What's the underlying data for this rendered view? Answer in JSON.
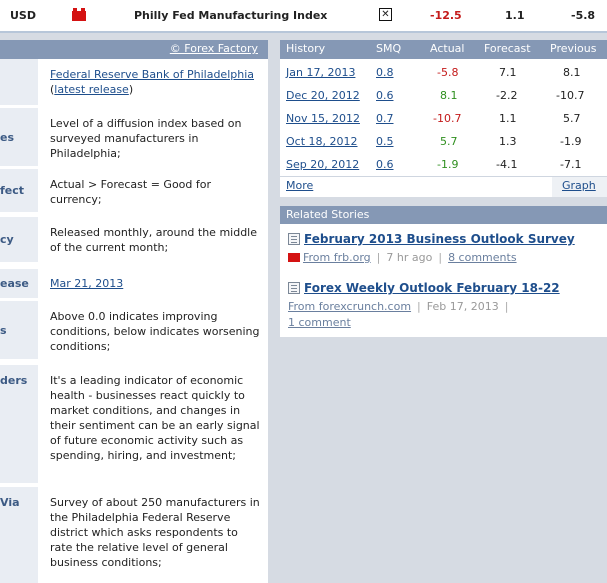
{
  "event": {
    "currency": "USD",
    "title": "Philly Fed Manufacturing Index",
    "checkbox": "✕",
    "actual": "-12.5",
    "forecast": "1.1",
    "previous": "-5.8"
  },
  "details": {
    "source_link": "© Forex Factory",
    "rows": [
      {
        "label": "",
        "value_parts": [
          "Federal Reserve Bank of Philadelphia",
          " (",
          "latest release",
          ")"
        ]
      },
      {
        "label": "es",
        "value": "Level of a diffusion index based on surveyed manufacturers in Philadelphia;"
      },
      {
        "label": "fect",
        "value": "Actual > Forecast = Good for currency;"
      },
      {
        "label": "cy",
        "value": "Released monthly, around the middle of the current month;"
      },
      {
        "label": "ease",
        "value": "Mar 21, 2013"
      },
      {
        "label": "s",
        "value": "Above 0.0 indicates improving conditions, below indicates worsening conditions;"
      },
      {
        "label": "ders",
        "value": "It's a leading indicator of economic health - businesses react quickly to market conditions, and changes in their sentiment can be an early signal of future economic activity such as spending, hiring, and investment;"
      },
      {
        "label": "Via",
        "value": "Survey of about 250 manufacturers in the Philadelphia Federal Reserve district which asks respondents to rate the relative level of general business conditions;"
      }
    ]
  },
  "history": {
    "headers": [
      "History",
      "SMQ",
      "Actual",
      "Forecast",
      "Previous"
    ],
    "rows": [
      {
        "date": "Jan 17, 2013",
        "smq": "0.8",
        "actual": "-5.8",
        "actual_color": "#c41a1a",
        "forecast": "7.1",
        "previous": "8.1"
      },
      {
        "date": "Dec 20, 2012",
        "smq": "0.6",
        "actual": "8.1",
        "actual_color": "#2f8f1f",
        "forecast": "-2.2",
        "previous": "-10.7"
      },
      {
        "date": "Nov 15, 2012",
        "smq": "0.7",
        "actual": "-10.7",
        "actual_color": "#c41a1a",
        "forecast": "1.1",
        "previous": "5.7"
      },
      {
        "date": "Oct 18, 2012",
        "smq": "0.5",
        "actual": "5.7",
        "actual_color": "#2f8f1f",
        "forecast": "1.3",
        "previous": "-1.9"
      },
      {
        "date": "Sep 20, 2012",
        "smq": "0.6",
        "actual": "-1.9",
        "actual_color": "#2f8f1f",
        "forecast": "-4.1",
        "previous": "-7.1"
      }
    ],
    "more_link": "More",
    "graph_link": "Graph"
  },
  "related": {
    "header": "Related Stories",
    "stories": [
      {
        "title": "February 2013 Business Outlook Survey",
        "source": "From frb.org",
        "time": "7 hr ago",
        "comments": "8 comments"
      },
      {
        "title": "Forex Weekly Outlook February 18-22",
        "source": "From forexcrunch.com",
        "time": "Feb 17, 2013",
        "comments": "1 comment"
      }
    ]
  }
}
